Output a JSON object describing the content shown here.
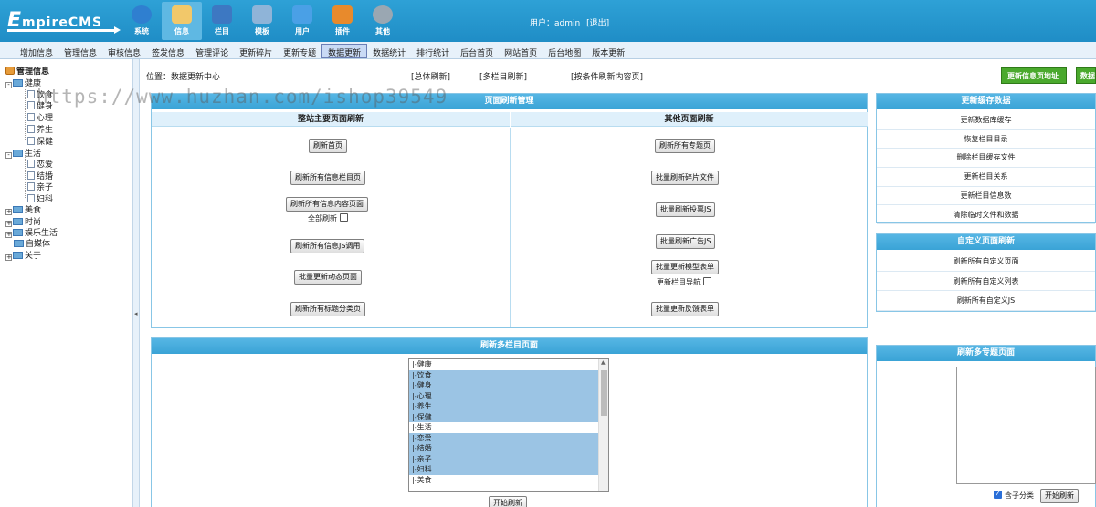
{
  "header": {
    "logo_prefix": "E",
    "logo_rest": "mpireCMS",
    "nav": [
      {
        "label": "系统",
        "icon": "globe-icon",
        "color": "#2f7fd0"
      },
      {
        "label": "信息",
        "icon": "edit-icon",
        "color": "#f2c86a"
      },
      {
        "label": "栏目",
        "icon": "folder-icon",
        "color": "#3d78c2"
      },
      {
        "label": "模板",
        "icon": "template-icon",
        "color": "#8fb4d8"
      },
      {
        "label": "用户",
        "icon": "user-icon",
        "color": "#4aa0e6"
      },
      {
        "label": "插件",
        "icon": "tools-icon",
        "color": "#e88a2c"
      },
      {
        "label": "其他",
        "icon": "gear-icon",
        "color": "#9aa7b2"
      }
    ],
    "user_label": "用户：",
    "user_name": "admin",
    "logout": "[退出]"
  },
  "submenu": [
    "增加信息",
    "管理信息",
    "审核信息",
    "签发信息",
    "管理评论",
    "更新碎片",
    "更新专题",
    "数据更新",
    "数据统计",
    "排行统计",
    "后台首页",
    "网站首页",
    "后台地图",
    "版本更新"
  ],
  "tree": {
    "root": "管理信息",
    "nodes": [
      "健康",
      "饮食",
      "健身",
      "心理",
      "养生",
      "保健",
      "生活",
      "恋爱",
      "结婚",
      "亲子",
      "妇科",
      "美食",
      "时尚",
      "娱乐生活",
      "自媒体",
      "关于"
    ]
  },
  "location": {
    "label": "位置：",
    "link": "数据更新中心",
    "all_refresh": "[总体刷新]",
    "multi_refresh": "[多栏目刷新]",
    "cond_refresh": "[按条件刷新内容页]",
    "btn_info_addr": "更新信息页地址",
    "btn_data": "数据"
  },
  "refresh_panel": {
    "title": "页面刷新管理",
    "left_title": "整站主要页面刷新",
    "right_title": "其他页面刷新",
    "left_buttons": [
      "刷新首页",
      "刷新所有信息栏目页",
      "刷新所有信息内容页面",
      "刷新所有信息JS调用",
      "批量更新动态页面",
      "刷新所有标题分类页"
    ],
    "all_refresh_label": "全部刷新",
    "right_buttons": [
      "刷新所有专题页",
      "批量刷新碎片文件",
      "批量刷新投票JS",
      "批量刷新广告JS",
      "批量更新模型表单",
      "批量更新反馈表单"
    ],
    "nav_update_label": "更新栏目导航"
  },
  "cache_panel": {
    "title": "更新缓存数据",
    "links": [
      "更新数据库缓存",
      "恢复栏目目录",
      "删除栏目缓存文件",
      "更新栏目关系",
      "更新栏目信息数",
      "清除临时文件和数据"
    ]
  },
  "custom_panel": {
    "title": "自定义页面刷新",
    "links": [
      "刷新所有自定义页面",
      "刷新所有自定义列表",
      "刷新所有自定义JS"
    ]
  },
  "multi_panel": {
    "title": "刷新多栏目页面",
    "options": [
      {
        "label": "|-健康",
        "selected": false
      },
      {
        "label": "|-饮食",
        "selected": true
      },
      {
        "label": "|-健身",
        "selected": true
      },
      {
        "label": "|-心理",
        "selected": true
      },
      {
        "label": "|-养生",
        "selected": true
      },
      {
        "label": "|-保健",
        "selected": true
      },
      {
        "label": "|-生活",
        "selected": false
      },
      {
        "label": "|-恋爱",
        "selected": true
      },
      {
        "label": "|-结婚",
        "selected": true
      },
      {
        "label": "|-亲子",
        "selected": true
      },
      {
        "label": "|-妇科",
        "selected": true
      },
      {
        "label": "|-美食",
        "selected": false
      }
    ],
    "start_btn": "开始刷新"
  },
  "topic_panel": {
    "title": "刷新多专题页面",
    "include_sub_label": "含子分类",
    "start_btn": "开始刷新"
  },
  "watermark": "https://www.huzhan.com/ishop39549"
}
